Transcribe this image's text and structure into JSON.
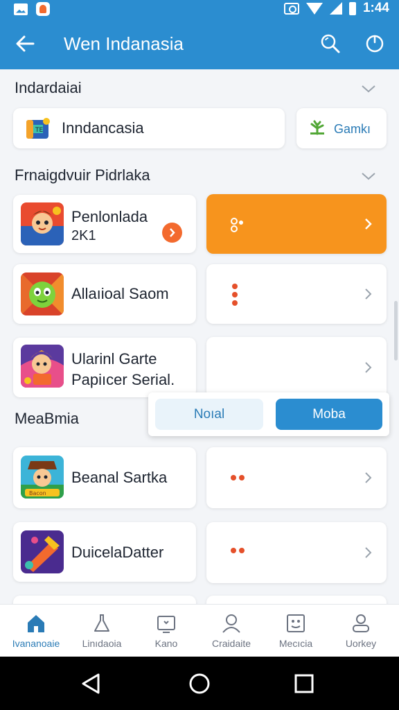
{
  "status_bar": {
    "time": "1:44"
  },
  "app_bar": {
    "title": "Wen Indanasia"
  },
  "section1": {
    "title": "Indardaiai",
    "field": "Inndancasia",
    "button": "Gamkı"
  },
  "section2": {
    "title": "Frnaigdvuir Pidrlaka",
    "items": [
      {
        "name": "Penlonlada",
        "sub": "2K1"
      },
      {
        "name": "Allaıioal Saom"
      },
      {
        "name": "Ularinl Garte",
        "sub": "Papiıcer Serial."
      }
    ]
  },
  "popup": {
    "option_a": "Noıal",
    "option_b": "Moba"
  },
  "section3": {
    "title": "MeaBmia",
    "items": [
      {
        "name": "Beanal Sartka"
      },
      {
        "name": "DuicelaDatter"
      }
    ]
  },
  "bottom_nav": {
    "items": [
      {
        "label": "Ivananoaie",
        "icon": "home-icon"
      },
      {
        "label": "Linıdaoia",
        "icon": "flask-icon"
      },
      {
        "label": "Kano",
        "icon": "screen-icon"
      },
      {
        "label": "Craidaite",
        "icon": "person-icon"
      },
      {
        "label": "Mecıcia",
        "icon": "face-box-icon"
      },
      {
        "label": "Uorkey",
        "icon": "profile-icon"
      }
    ]
  },
  "colors": {
    "primary": "#2b8dd0",
    "accent": "#f7941d",
    "dot": "#e5502a"
  }
}
